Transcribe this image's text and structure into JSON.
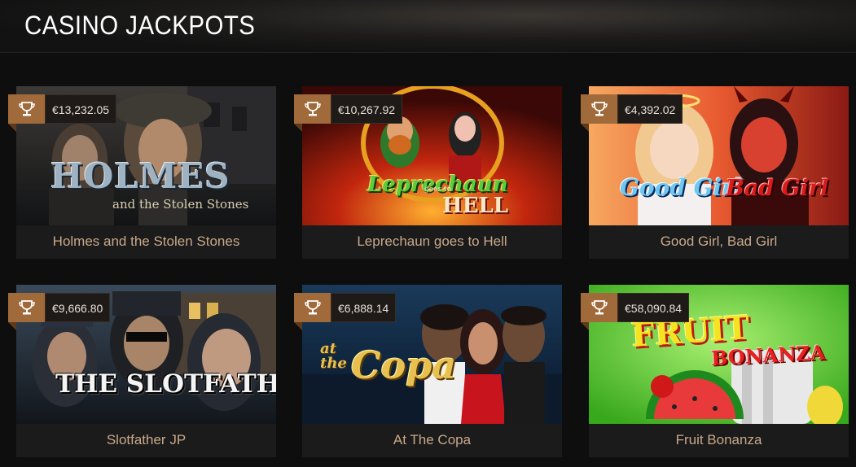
{
  "header": {
    "title": "CASINO JACKPOTS"
  },
  "colors": {
    "badge_accent": "#a06a3a",
    "caption_text": "#c8a98a",
    "background": "#0e0e0e"
  },
  "games": [
    {
      "name": "Holmes and the Stolen Stones",
      "jackpot": "€13,232.05",
      "icon": "trophy-icon",
      "art_title": "HOLMES",
      "art_subtitle": "and the Stolen Stones"
    },
    {
      "name": "Leprechaun goes to Hell",
      "jackpot": "€10,267.92",
      "icon": "trophy-icon",
      "art_title": "Leprechaun",
      "art_subtitle": "HELL",
      "art_connector": "goes to"
    },
    {
      "name": "Good Girl, Bad Girl",
      "jackpot": "€4,392.02",
      "icon": "trophy-icon",
      "art_title": "Good Girl",
      "art_subtitle": "Bad Girl"
    },
    {
      "name": "Slotfather JP",
      "jackpot": "€9,666.80",
      "icon": "trophy-icon",
      "art_title": "THE SLOTFATHER"
    },
    {
      "name": "At The Copa",
      "jackpot": "€6,888.14",
      "icon": "trophy-icon",
      "art_title": "Copa",
      "art_subtitle": "at the"
    },
    {
      "name": "Fruit Bonanza",
      "jackpot": "€58,090.84",
      "icon": "trophy-icon",
      "art_title": "FRUIT",
      "art_subtitle": "BONANZA"
    }
  ]
}
